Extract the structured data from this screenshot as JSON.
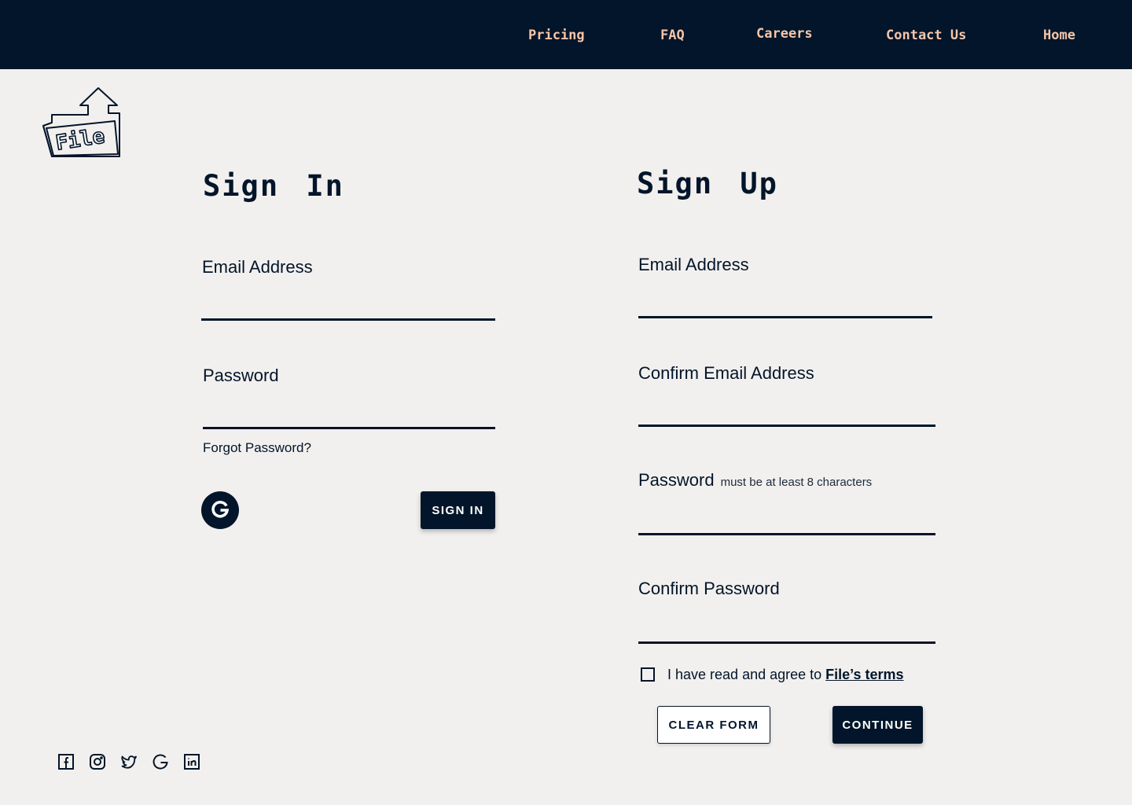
{
  "nav": {
    "links": [
      "Pricing",
      "FAQ",
      "Careers",
      "Contact Us",
      "Home"
    ]
  },
  "logo": {
    "text": "File"
  },
  "sign_in": {
    "title": "Sign In",
    "email_label": "Email Address",
    "email_value": "",
    "password_label": "Password",
    "password_value": "",
    "forgot_label": "Forgot Password?",
    "google_icon": "google-g-icon",
    "submit_label": "SIGN IN"
  },
  "sign_up": {
    "title": "Sign Up",
    "email_label": "Email Address",
    "email_value": "",
    "confirm_email_label": "Confirm Email Address",
    "confirm_email_value": "",
    "password_label": "Password",
    "password_hint": "must be at least 8 characters",
    "password_value": "",
    "confirm_password_label": "Confirm Password",
    "confirm_password_value": "",
    "terms_prefix": "I have read and agree to",
    "terms_link": "File’s terms",
    "terms_checked": false,
    "clear_label": "CLEAR FORM",
    "continue_label": "CONTINUE"
  },
  "social": [
    "facebook-icon",
    "instagram-icon",
    "twitter-icon",
    "google-icon",
    "linkedin-icon"
  ],
  "colors": {
    "navy": "#02152a",
    "nav_link": "#f5c5a8",
    "background": "#f2f0ee"
  }
}
